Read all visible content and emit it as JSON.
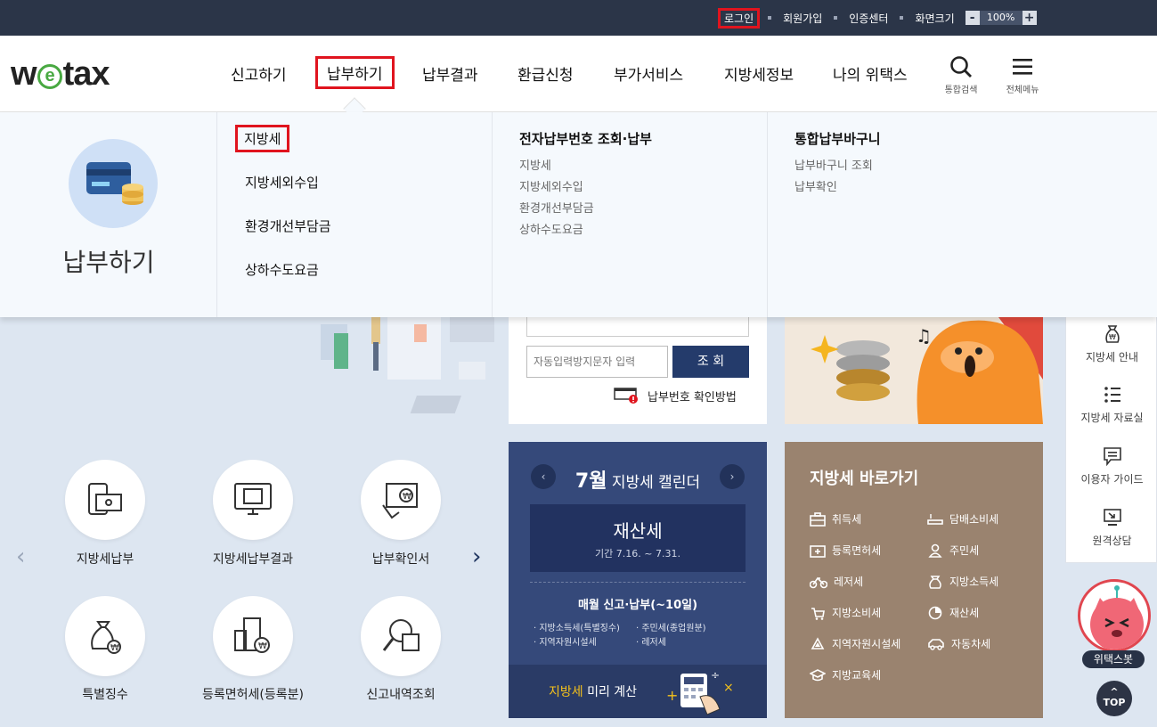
{
  "util": {
    "login": "로그인",
    "signup": "회원가입",
    "cert": "인증센터",
    "screen_size": "화면크기",
    "zoom_minus": "-",
    "zoom_value": "100%",
    "zoom_plus": "+"
  },
  "header": {
    "logo_w": "w",
    "logo_e": "e",
    "logo_tax": "tax",
    "nav": [
      "신고하기",
      "납부하기",
      "납부결과",
      "환급신청",
      "부가서비스",
      "지방세정보",
      "나의 위택스"
    ],
    "search_label": "통합검색",
    "menu_label": "전체메뉴"
  },
  "mega": {
    "title": "납부하기",
    "col1": [
      "지방세",
      "지방세외수입",
      "환경개선부담금",
      "상하수도요금"
    ],
    "col2": {
      "heading": "전자납부번호 조회·납부",
      "items": [
        "지방세",
        "지방세외수입",
        "환경개선부담금",
        "상하수도요금"
      ]
    },
    "col3": {
      "heading": "통합납부바구니",
      "items": [
        "납부바구니 조회",
        "납부확인"
      ]
    }
  },
  "lookup": {
    "captcha_placeholder": "자동입력방지문자 입력",
    "submit_label": "조 회",
    "help_label": "납부번호 확인방법"
  },
  "quick": [
    {
      "label": "지방세납부"
    },
    {
      "label": "지방세납부결과"
    },
    {
      "label": "납부확인서"
    },
    {
      "label": "특별징수"
    },
    {
      "label": "등록면허세(등록분)"
    },
    {
      "label": "신고내역조회"
    }
  ],
  "calendar": {
    "month": "7월",
    "title": "지방세 캘린더",
    "prev": "‹",
    "next": "›",
    "tax_name": "재산세",
    "period": "기간 7.16. ~ 7.31.",
    "monthly_title": "매월 신고·납부(~10일)",
    "monthly_items": [
      "지방소득세(특별징수)",
      "주민세(종업원분)",
      "지역자원시설세",
      "레저세"
    ],
    "calc_highlight": "지방세",
    "calc_rest": " 미리 계산"
  },
  "shortcut": {
    "title": "지방세 바로가기",
    "items": [
      "취득세",
      "담배소비세",
      "등록면허세",
      "주민세",
      "레저세",
      "지방소득세",
      "지방소비세",
      "재산세",
      "지역자원시설세",
      "자동차세",
      "지방교육세"
    ]
  },
  "side": {
    "items": [
      "지방세 안내",
      "지방세 자료실",
      "이용자 가이드",
      "원격상담"
    ],
    "mascot_label": "위택스봇",
    "top_label": "TOP"
  },
  "colors": {
    "topbar": "#2b3548",
    "highlight": "#e0141e",
    "calendar_bg": "#35497a",
    "shortcut_bg": "#9a836f",
    "logo_green": "#49a942"
  }
}
